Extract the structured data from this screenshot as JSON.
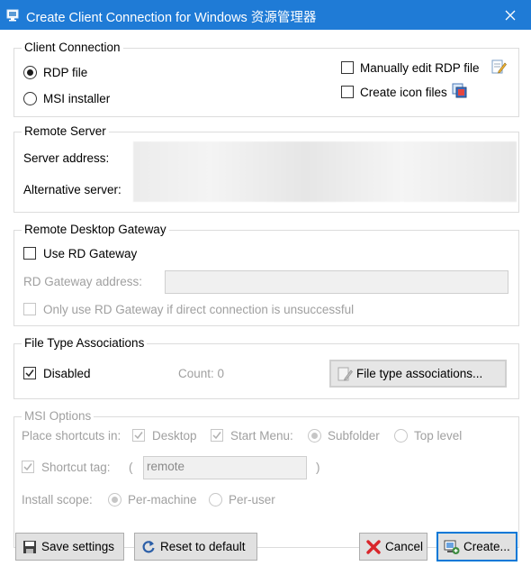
{
  "window": {
    "title": "Create Client Connection for Windows 资源管理器"
  },
  "client_connection": {
    "group_label": "Client Connection",
    "rdp_file_label": "RDP file",
    "msi_installer_label": "MSI installer",
    "manually_edit_label": "Manually edit RDP file",
    "create_icon_files_label": "Create icon files"
  },
  "remote_server": {
    "group_label": "Remote Server",
    "server_address_label": "Server address:",
    "alternative_server_label": "Alternative server:"
  },
  "gateway": {
    "group_label": "Remote Desktop Gateway",
    "use_rd_gateway_label": "Use RD Gateway",
    "rd_gateway_address_label": "RD Gateway address:",
    "only_use_label": "Only use RD Gateway if direct connection is unsuccessful"
  },
  "file_types": {
    "group_label": "File Type Associations",
    "disabled_label": "Disabled",
    "count_label": "Count: 0",
    "button_label": "File type associations..."
  },
  "msi_options": {
    "group_label": "MSI Options",
    "place_shortcuts_label": "Place shortcuts in:",
    "desktop_label": "Desktop",
    "start_menu_label": "Start Menu:",
    "subfolder_label": "Subfolder",
    "top_level_label": "Top level",
    "shortcut_tag_label": "Shortcut tag:",
    "paren_open": "(",
    "paren_close": ")",
    "shortcut_tag_value": "remote",
    "install_scope_label": "Install scope:",
    "per_machine_label": "Per-machine",
    "per_user_label": "Per-user"
  },
  "buttons": {
    "save_settings": "Save settings",
    "reset_to_default": "Reset to default",
    "cancel": "Cancel",
    "create": "Create..."
  },
  "colors": {
    "titlebar": "#1f7bd6",
    "primary_border": "#0078d7",
    "cancel_icon": "#d9262b"
  },
  "icons": [
    "app-icon",
    "close-icon",
    "edit-rdp-icon",
    "icon-files-icon",
    "file-types-icon",
    "save-icon",
    "reset-icon",
    "cancel-icon",
    "create-icon"
  ]
}
